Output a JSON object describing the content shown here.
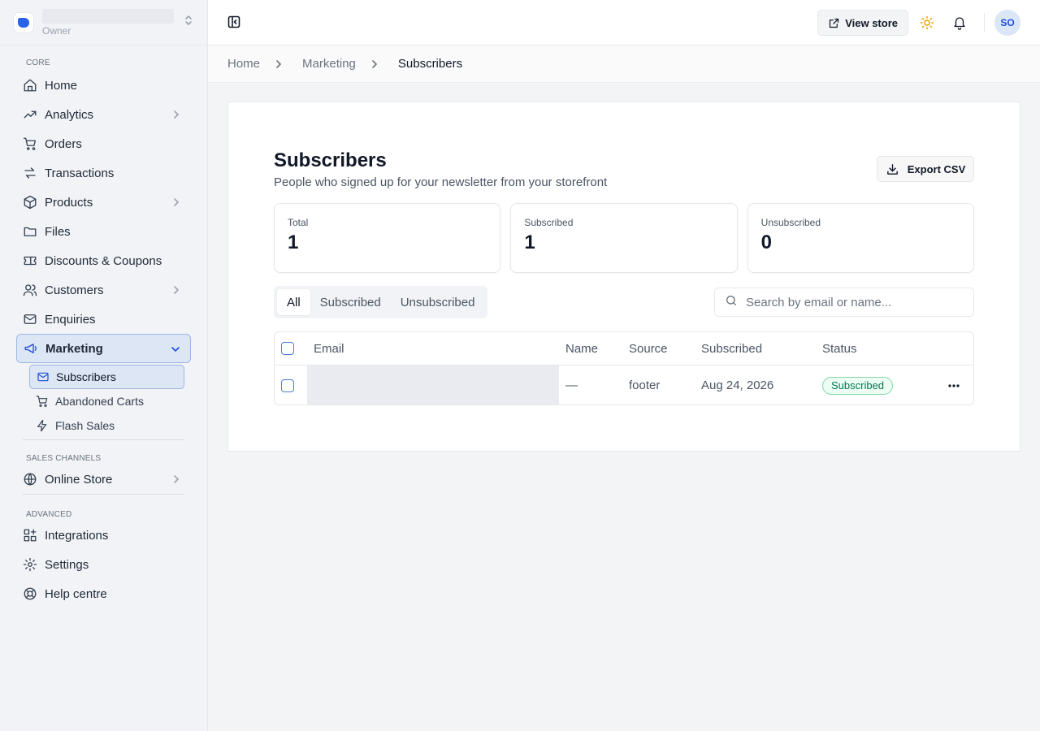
{
  "store": {
    "role": "Owner"
  },
  "sections": {
    "core": "CORE",
    "sales_channels": "SALES CHANNELS",
    "advanced": "ADVANCED"
  },
  "nav": {
    "home": "Home",
    "analytics": "Analytics",
    "orders": "Orders",
    "transactions": "Transactions",
    "products": "Products",
    "files": "Files",
    "discounts": "Discounts & Coupons",
    "customers": "Customers",
    "enquiries": "Enquiries",
    "marketing": "Marketing",
    "marketing_sub": {
      "subscribers": "Subscribers",
      "abandoned_carts": "Abandoned Carts",
      "flash_sales": "Flash Sales"
    },
    "online_store": "Online Store",
    "integrations": "Integrations",
    "settings": "Settings",
    "help": "Help centre"
  },
  "topbar": {
    "view_store": "View store",
    "avatar_initials": "SO"
  },
  "breadcrumb": [
    "Home",
    "Marketing",
    "Subscribers"
  ],
  "page": {
    "title": "Subscribers",
    "subtitle": "People who signed up for your newsletter from your storefront",
    "export_label": "Export CSV"
  },
  "stats": [
    {
      "label": "Total",
      "value": "1"
    },
    {
      "label": "Subscribed",
      "value": "1"
    },
    {
      "label": "Unsubscribed",
      "value": "0"
    }
  ],
  "filters": {
    "tabs": [
      "All",
      "Subscribed",
      "Unsubscribed"
    ],
    "active": "All",
    "search_placeholder": "Search by email or name..."
  },
  "table": {
    "columns": [
      "Email",
      "Name",
      "Source",
      "Subscribed",
      "Status"
    ],
    "rows": [
      {
        "email": "",
        "name": "—",
        "source": "footer",
        "subscribed": "Aug 24, 2026",
        "status": "Subscribed"
      }
    ]
  },
  "colors": {
    "accent": "#2563eb",
    "active_nav_bg": "#dde6f5",
    "status_green": "#047857"
  }
}
